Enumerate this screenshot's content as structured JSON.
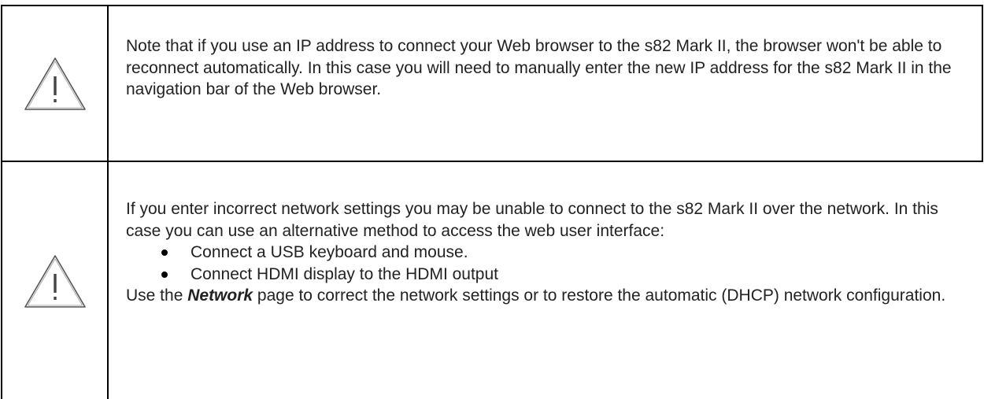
{
  "notes": [
    {
      "icon": "warning-triangle-icon",
      "text": "Note that if you use an IP address to connect your Web browser to the s82 Mark II, the browser won't be able to reconnect automatically. In this case you will need to manually enter the new IP address for the s82 Mark II in the navigation bar of the Web browser."
    },
    {
      "icon": "warning-triangle-icon",
      "intro": "If you enter incorrect network settings you may be unable to connect to the s82 Mark II over the network. In this case you can use an alternative method to access the web user interface:",
      "bullets": [
        "Connect a USB keyboard and mouse.",
        "Connect HDMI display to the HDMI output"
      ],
      "outro_prefix": "Use the ",
      "outro_emphasis": "Network",
      "outro_suffix": " page to correct the network settings or to restore the automatic (DHCP) network configuration."
    }
  ]
}
